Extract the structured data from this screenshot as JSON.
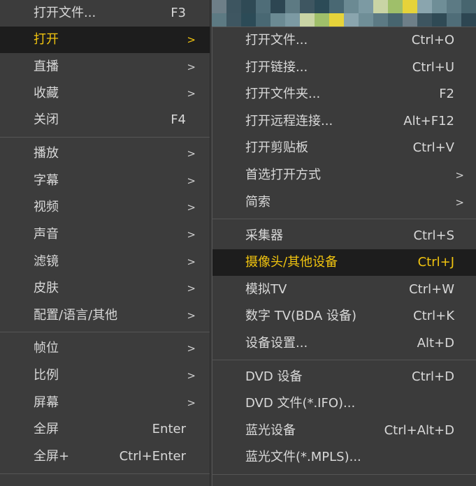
{
  "background_pixels": [
    "#6e7f88",
    "#3d5560",
    "#2f4a55",
    "#4f6d78",
    "#2d4652",
    "#5d7a83",
    "#3e5661",
    "#2c4b57",
    "#496873",
    "#6b8a93",
    "#7c9aa3",
    "#c9d4a5",
    "#9fbf6a",
    "#e6d33a",
    "#8aa5ae",
    "#6f8e97",
    "#5c7a84",
    "#47656f"
  ],
  "main_menu": {
    "items": [
      {
        "label": "打开文件...",
        "shortcut": "F3",
        "arrow": ""
      },
      {
        "label": "打开",
        "shortcut": "",
        "arrow": ">",
        "active": true
      },
      {
        "label": "直播",
        "shortcut": "",
        "arrow": ">"
      },
      {
        "label": "收藏",
        "shortcut": "",
        "arrow": ">"
      },
      {
        "label": "关闭",
        "shortcut": "F4",
        "arrow": ""
      },
      {
        "label": "播放",
        "shortcut": "",
        "arrow": ">"
      },
      {
        "label": "字幕",
        "shortcut": "",
        "arrow": ">"
      },
      {
        "label": "视频",
        "shortcut": "",
        "arrow": ">"
      },
      {
        "label": "声音",
        "shortcut": "",
        "arrow": ">"
      },
      {
        "label": "滤镜",
        "shortcut": "",
        "arrow": ">"
      },
      {
        "label": "皮肤",
        "shortcut": "",
        "arrow": ">"
      },
      {
        "label": "配置/语言/其他",
        "shortcut": "",
        "arrow": ">"
      },
      {
        "label": "帧位",
        "shortcut": "",
        "arrow": ">"
      },
      {
        "label": "比例",
        "shortcut": "",
        "arrow": ">"
      },
      {
        "label": "屏幕",
        "shortcut": "",
        "arrow": ">"
      },
      {
        "label": "全屏",
        "shortcut": "Enter",
        "arrow": ""
      },
      {
        "label": "全屏+",
        "shortcut": "Ctrl+Enter",
        "arrow": ""
      }
    ]
  },
  "sub_menu": {
    "items": [
      {
        "label": "打开文件...",
        "shortcut": "Ctrl+O",
        "arrow": ""
      },
      {
        "label": "打开链接...",
        "shortcut": "Ctrl+U",
        "arrow": ""
      },
      {
        "label": "打开文件夹...",
        "shortcut": "F2",
        "arrow": ""
      },
      {
        "label": "打开远程连接...",
        "shortcut": "Alt+F12",
        "arrow": ""
      },
      {
        "label": "打开剪贴板",
        "shortcut": "Ctrl+V",
        "arrow": ""
      },
      {
        "label": "首选打开方式",
        "shortcut": "",
        "arrow": ">"
      },
      {
        "label": "简索",
        "shortcut": "",
        "arrow": ">"
      },
      {
        "label": "采集器",
        "shortcut": "Ctrl+S",
        "arrow": ""
      },
      {
        "label": "摄像头/其他设备",
        "shortcut": "Ctrl+J",
        "arrow": "",
        "active": true
      },
      {
        "label": "模拟TV",
        "shortcut": "Ctrl+W",
        "arrow": ""
      },
      {
        "label": "数字 TV(BDA 设备)",
        "shortcut": "Ctrl+K",
        "arrow": ""
      },
      {
        "label": "设备设置...",
        "shortcut": "Alt+D",
        "arrow": ""
      },
      {
        "label": "DVD 设备",
        "shortcut": "Ctrl+D",
        "arrow": ""
      },
      {
        "label": "DVD 文件(*.IFO)...",
        "shortcut": "",
        "arrow": ""
      },
      {
        "label": "蓝光设备",
        "shortcut": "Ctrl+Alt+D",
        "arrow": ""
      },
      {
        "label": "蓝光文件(*.MPLS)...",
        "shortcut": "",
        "arrow": ""
      }
    ]
  },
  "colors": {
    "menu_bg": "#3c3c3c",
    "active_bg": "#1d1d1d",
    "active_text": "#f1c40f",
    "text": "#d8d8d8",
    "separator": "#555555"
  }
}
